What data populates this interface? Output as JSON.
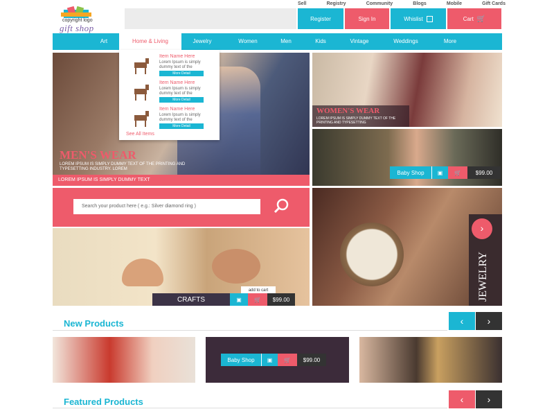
{
  "logo": {
    "line1": "copyright logo",
    "line2": "gift shop"
  },
  "top_links": [
    "Sell",
    "Registry",
    "Community",
    "Blogs",
    "Mobile",
    "Gift Cards"
  ],
  "account": {
    "register": "Register",
    "signin": "Sign In",
    "wishlist": "Whislist",
    "cart": "Cart"
  },
  "nav": [
    "Art",
    "Home & Living",
    "Jewelry",
    "Women",
    "Men",
    "Kids",
    "Vintage",
    "Weddings",
    "More"
  ],
  "dropdown": {
    "items": [
      {
        "name": "Item Name Here",
        "desc": "Lorem Ipsum is simply dummy text of the",
        "button": "More Detail"
      },
      {
        "name": "Item Name Here",
        "desc": "Lorem Ipsum is simply dummy text of the",
        "button": "More Detail"
      },
      {
        "name": "Item Name Here",
        "desc": "Lorem Ipsum is simply dummy text of the",
        "button": "More Detail"
      }
    ],
    "see_all": "See All Items"
  },
  "mens": {
    "title": "MEN'S WEAR",
    "sub": "LOREM IPSUM IS SIMPLY DUMMY TEXT OF THE PRINTING AND TYPESETTING INDUSTRY. LOREM",
    "band": "LOREM IPSUM IS SIMPLY DUMMY TEXT"
  },
  "womens": {
    "title": "WOMEN'S WEAR",
    "sub": "LOREM IPSUM IS SIMPLY DUMMY TEXT OF THE PRINTING AND TYPESETTING"
  },
  "baby": {
    "label": "Baby Shop",
    "price": "$99.00"
  },
  "search": {
    "placeholder": "Search your product here ( e.g.: Silver diamond ring )"
  },
  "crafts": {
    "label": "CRAFTS",
    "price": "$99.00",
    "tooltip": "add to cart"
  },
  "jewelry": {
    "label": "JEWELRY"
  },
  "new_products": {
    "title": "New Products",
    "baby_label": "Baby Shop",
    "price": "$99.00"
  },
  "featured": {
    "title": "Featured Products"
  },
  "colors": {
    "accent": "#ee5b6b",
    "cyan": "#1bb6d3",
    "dark": "#333333"
  }
}
